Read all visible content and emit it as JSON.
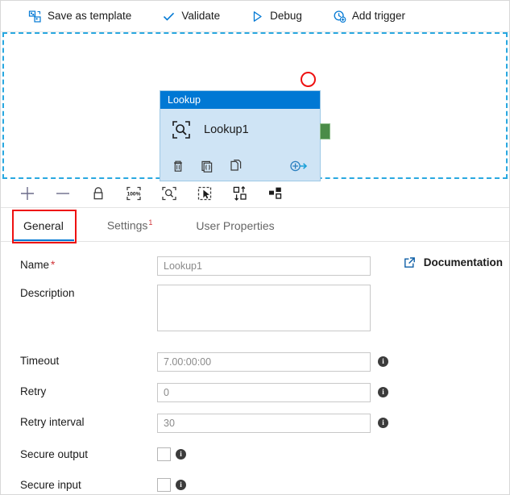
{
  "toolbar": {
    "items": [
      {
        "label": "Save as template",
        "icon": "save-template-icon"
      },
      {
        "label": "Validate",
        "icon": "checkmark-icon"
      },
      {
        "label": "Debug",
        "icon": "play-triangle-icon"
      },
      {
        "label": "Add trigger",
        "icon": "add-trigger-clock-icon"
      }
    ]
  },
  "canvas": {
    "node": {
      "type_label": "Lookup",
      "name": "Lookup1",
      "icon": "lookup-magnifier-icon",
      "actions": [
        {
          "name": "delete-icon",
          "title": "Delete"
        },
        {
          "name": "code-icon",
          "title": "Code"
        },
        {
          "name": "clone-icon",
          "title": "Clone"
        },
        {
          "name": "add-output-icon",
          "title": "Add output"
        }
      ],
      "output_port": "success-output-port"
    },
    "annotation": "red-circle-annotation",
    "tools": [
      {
        "name": "zoom-in-icon",
        "title": "Zoom in"
      },
      {
        "name": "zoom-out-icon",
        "title": "Zoom out"
      },
      {
        "name": "lock-icon",
        "title": "Lock canvas"
      },
      {
        "name": "zoom-100-icon",
        "title": "Zoom to 100%"
      },
      {
        "name": "zoom-to-fit-icon",
        "title": "Zoom to fit"
      },
      {
        "name": "select-all-icon",
        "title": "Select all"
      },
      {
        "name": "auto-align-icon",
        "title": "Auto align"
      },
      {
        "name": "layout-icon",
        "title": "Auto layout"
      }
    ]
  },
  "tabs": [
    {
      "label": "General",
      "badge": "",
      "active": true
    },
    {
      "label": "Settings",
      "badge": "1",
      "active": false
    },
    {
      "label": "User Properties",
      "badge": "",
      "active": false
    }
  ],
  "documentation": {
    "label": "Documentation",
    "icon": "external-link-icon"
  },
  "form": {
    "name": {
      "label": "Name",
      "required": "*",
      "value": "Lookup1",
      "placeholder": "Lookup1"
    },
    "description": {
      "label": "Description",
      "value": "",
      "placeholder": ""
    },
    "timeout": {
      "label": "Timeout",
      "value": "7.00:00:00",
      "placeholder": "7.00:00:00"
    },
    "retry": {
      "label": "Retry",
      "value": "0",
      "placeholder": "0"
    },
    "retry_interval": {
      "label": "Retry interval",
      "value": "30",
      "placeholder": "30"
    },
    "secure_output": {
      "label": "Secure output",
      "checked": false
    },
    "secure_input": {
      "label": "Secure input",
      "checked": false
    },
    "info_glyph": "i"
  },
  "colors": {
    "accent": "#0078d4",
    "node_body": "#cfe4f5",
    "node_header": "#0078d4",
    "canvas_border": "#29a8e0",
    "annotation": "#ee1111",
    "port_green": "#4a8c48",
    "required_red": "#d13438"
  }
}
